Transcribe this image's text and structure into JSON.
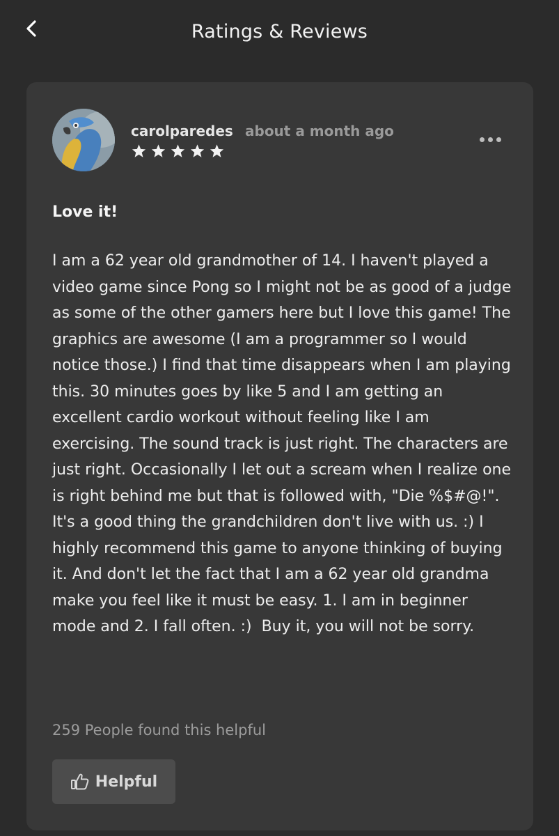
{
  "header": {
    "title": "Ratings & Reviews",
    "back_icon": "chevron-left-icon"
  },
  "review": {
    "username": "carolparedes",
    "timestamp": "about a month ago",
    "rating": 5,
    "rating_max": 5,
    "title": "Love it!",
    "body": "I am a 62 year old grandmother of 14. I haven't played a video game since Pong so I might not be as good of a judge as some of the other gamers here but I love this game! The graphics are awesome (I am a programmer so I would notice those.) I find that time disappears when I am playing this. 30 minutes goes by like 5 and I am getting an excellent cardio workout without feeling like I am exercising. The sound track is just right. The characters are just right. Occasionally I let out a scream when I realize one is right behind me but that is followed with, \"Die %$#@!\". It's a good thing the grandchildren don't live with us. :) I highly recommend this game to anyone thinking of buying it. And don't let the fact that I am a 62 year old grandma make you feel like it must be easy. 1. I am in beginner mode and 2. I fall often. :)  Buy it, you will not be sorry.",
    "helpful_count_text": "259 People found this helpful",
    "helpful_button_label": "Helpful",
    "more_icon": "more-horizontal-icon",
    "helpful_icon": "thumbs-up-icon"
  },
  "colors": {
    "background": "#2b2b2b",
    "card": "#383838",
    "button": "#4c4c4c",
    "muted_text": "#9c9c9c"
  }
}
